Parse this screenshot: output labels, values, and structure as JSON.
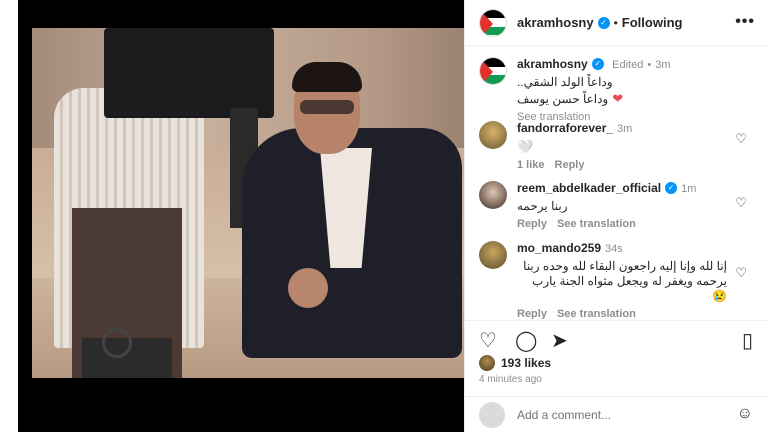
{
  "post": {
    "author": "akramhosny",
    "following_label": "Following",
    "more_icon": "•••"
  },
  "caption": {
    "author": "akramhosny",
    "edited": "Edited",
    "time": "3m",
    "line1": "وداعاً الولد الشقي..",
    "line2": "وداعاً حسن يوسف",
    "see_translation": "See translation"
  },
  "comments": [
    {
      "user": "fandorraforever_",
      "time": "3m",
      "text": "🤍",
      "likes": "1 like",
      "reply": "Reply",
      "translate": ""
    },
    {
      "user": "reem_abdelkader_official",
      "time": "1m",
      "text": "ربنا يرحمه",
      "likes": "",
      "reply": "Reply",
      "translate": "See translation"
    },
    {
      "user": "mo_mando259",
      "time": "34s",
      "text": "إنا لله وإنا إليه راجعون البقاء لله وحده ربنا يرحمه ويغفر له ويجعل مثواه الجنة يارب 😢",
      "likes": "",
      "reply": "Reply",
      "translate": "See translation"
    }
  ],
  "footer": {
    "likes": "193 likes",
    "ago": "4 minutes ago",
    "add_comment_placeholder": "Add a comment..."
  },
  "colors": {
    "verified": "#0095f6",
    "heart": "#ed4956",
    "muted": "#8e8e8e"
  }
}
